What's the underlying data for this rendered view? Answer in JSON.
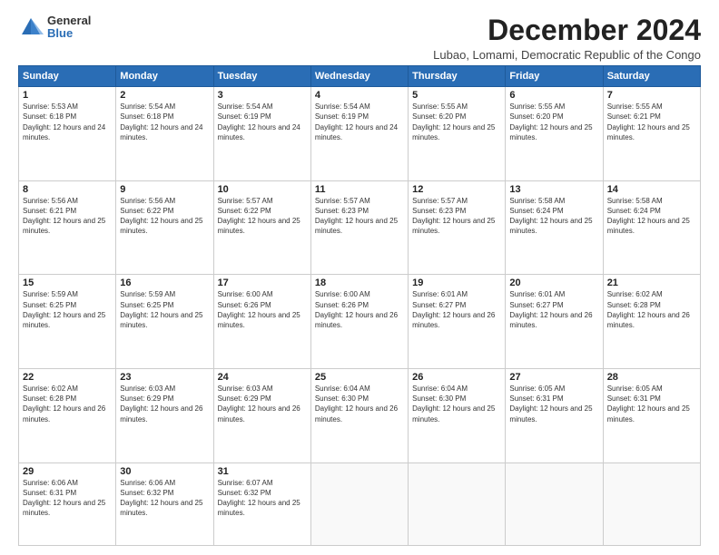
{
  "logo": {
    "general": "General",
    "blue": "Blue"
  },
  "title": "December 2024",
  "subtitle": "Lubao, Lomami, Democratic Republic of the Congo",
  "days_of_week": [
    "Sunday",
    "Monday",
    "Tuesday",
    "Wednesday",
    "Thursday",
    "Friday",
    "Saturday"
  ],
  "weeks": [
    [
      {
        "day": "1",
        "sunrise": "5:53 AM",
        "sunset": "6:18 PM",
        "daylight": "12 hours and 24 minutes."
      },
      {
        "day": "2",
        "sunrise": "5:54 AM",
        "sunset": "6:18 PM",
        "daylight": "12 hours and 24 minutes."
      },
      {
        "day": "3",
        "sunrise": "5:54 AM",
        "sunset": "6:19 PM",
        "daylight": "12 hours and 24 minutes."
      },
      {
        "day": "4",
        "sunrise": "5:54 AM",
        "sunset": "6:19 PM",
        "daylight": "12 hours and 24 minutes."
      },
      {
        "day": "5",
        "sunrise": "5:55 AM",
        "sunset": "6:20 PM",
        "daylight": "12 hours and 25 minutes."
      },
      {
        "day": "6",
        "sunrise": "5:55 AM",
        "sunset": "6:20 PM",
        "daylight": "12 hours and 25 minutes."
      },
      {
        "day": "7",
        "sunrise": "5:55 AM",
        "sunset": "6:21 PM",
        "daylight": "12 hours and 25 minutes."
      }
    ],
    [
      {
        "day": "8",
        "sunrise": "5:56 AM",
        "sunset": "6:21 PM",
        "daylight": "12 hours and 25 minutes."
      },
      {
        "day": "9",
        "sunrise": "5:56 AM",
        "sunset": "6:22 PM",
        "daylight": "12 hours and 25 minutes."
      },
      {
        "day": "10",
        "sunrise": "5:57 AM",
        "sunset": "6:22 PM",
        "daylight": "12 hours and 25 minutes."
      },
      {
        "day": "11",
        "sunrise": "5:57 AM",
        "sunset": "6:23 PM",
        "daylight": "12 hours and 25 minutes."
      },
      {
        "day": "12",
        "sunrise": "5:57 AM",
        "sunset": "6:23 PM",
        "daylight": "12 hours and 25 minutes."
      },
      {
        "day": "13",
        "sunrise": "5:58 AM",
        "sunset": "6:24 PM",
        "daylight": "12 hours and 25 minutes."
      },
      {
        "day": "14",
        "sunrise": "5:58 AM",
        "sunset": "6:24 PM",
        "daylight": "12 hours and 25 minutes."
      }
    ],
    [
      {
        "day": "15",
        "sunrise": "5:59 AM",
        "sunset": "6:25 PM",
        "daylight": "12 hours and 25 minutes."
      },
      {
        "day": "16",
        "sunrise": "5:59 AM",
        "sunset": "6:25 PM",
        "daylight": "12 hours and 25 minutes."
      },
      {
        "day": "17",
        "sunrise": "6:00 AM",
        "sunset": "6:26 PM",
        "daylight": "12 hours and 25 minutes."
      },
      {
        "day": "18",
        "sunrise": "6:00 AM",
        "sunset": "6:26 PM",
        "daylight": "12 hours and 26 minutes."
      },
      {
        "day": "19",
        "sunrise": "6:01 AM",
        "sunset": "6:27 PM",
        "daylight": "12 hours and 26 minutes."
      },
      {
        "day": "20",
        "sunrise": "6:01 AM",
        "sunset": "6:27 PM",
        "daylight": "12 hours and 26 minutes."
      },
      {
        "day": "21",
        "sunrise": "6:02 AM",
        "sunset": "6:28 PM",
        "daylight": "12 hours and 26 minutes."
      }
    ],
    [
      {
        "day": "22",
        "sunrise": "6:02 AM",
        "sunset": "6:28 PM",
        "daylight": "12 hours and 26 minutes."
      },
      {
        "day": "23",
        "sunrise": "6:03 AM",
        "sunset": "6:29 PM",
        "daylight": "12 hours and 26 minutes."
      },
      {
        "day": "24",
        "sunrise": "6:03 AM",
        "sunset": "6:29 PM",
        "daylight": "12 hours and 26 minutes."
      },
      {
        "day": "25",
        "sunrise": "6:04 AM",
        "sunset": "6:30 PM",
        "daylight": "12 hours and 26 minutes."
      },
      {
        "day": "26",
        "sunrise": "6:04 AM",
        "sunset": "6:30 PM",
        "daylight": "12 hours and 25 minutes."
      },
      {
        "day": "27",
        "sunrise": "6:05 AM",
        "sunset": "6:31 PM",
        "daylight": "12 hours and 25 minutes."
      },
      {
        "day": "28",
        "sunrise": "6:05 AM",
        "sunset": "6:31 PM",
        "daylight": "12 hours and 25 minutes."
      }
    ],
    [
      {
        "day": "29",
        "sunrise": "6:06 AM",
        "sunset": "6:31 PM",
        "daylight": "12 hours and 25 minutes."
      },
      {
        "day": "30",
        "sunrise": "6:06 AM",
        "sunset": "6:32 PM",
        "daylight": "12 hours and 25 minutes."
      },
      {
        "day": "31",
        "sunrise": "6:07 AM",
        "sunset": "6:32 PM",
        "daylight": "12 hours and 25 minutes."
      },
      null,
      null,
      null,
      null
    ]
  ]
}
